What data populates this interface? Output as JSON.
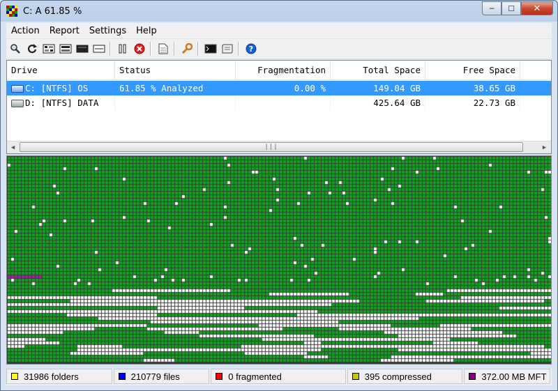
{
  "window": {
    "title": "C:  A  61.85 %"
  },
  "menu": [
    "Action",
    "Report",
    "Settings",
    "Help"
  ],
  "toolbar": [
    {
      "icon": "magnifier-icon",
      "name": "analyze-button"
    },
    {
      "icon": "refresh-icon",
      "name": "defragment-button"
    },
    {
      "icon": "quick-optimize-icon",
      "name": "quick-optimize-button"
    },
    {
      "icon": "full-optimize-icon",
      "name": "full-optimize-button"
    },
    {
      "icon": "mft-optimize-icon",
      "name": "mft-optimize-button"
    },
    {
      "icon": "sep"
    },
    {
      "icon": "pause-icon",
      "name": "pause-button"
    },
    {
      "icon": "stop-icon",
      "name": "stop-button"
    },
    {
      "icon": "sep"
    },
    {
      "icon": "report-icon",
      "name": "report-button"
    },
    {
      "icon": "sep"
    },
    {
      "icon": "wrench-icon",
      "name": "settings-button"
    },
    {
      "icon": "sep"
    },
    {
      "icon": "console-icon",
      "name": "boot-time-button"
    },
    {
      "icon": "script-icon",
      "name": "script-button"
    },
    {
      "icon": "sep"
    },
    {
      "icon": "help-icon",
      "name": "help-button"
    }
  ],
  "drives": {
    "columns": [
      "Drive",
      "Status",
      "Fragmentation",
      "Total Space",
      "Free Space",
      "% "
    ],
    "rows": [
      {
        "drive": "C: [NTFS]  OS",
        "status": "61.85 % Analyzed",
        "fragmentation": "0.00 %",
        "total": "149.04 GB",
        "free": "38.65 GB",
        "selected": true
      },
      {
        "drive": "D: [NTFS]  DATA",
        "status": "",
        "fragmentation": "",
        "total": "425.64 GB",
        "free": "22.73 GB",
        "selected": false
      }
    ]
  },
  "cluster_map": {
    "colors": {
      "used": "#0ca61c",
      "free": "#ffffff",
      "mft": "#a020a0",
      "grid": "#3a3a3a"
    },
    "legend": [
      "green = used",
      "white = free space",
      "magenta = MFT"
    ],
    "analyzed_progress": 0.6185
  },
  "status_bar": [
    {
      "label": "31986 folders",
      "color": "#ffff00"
    },
    {
      "label": "210779 files",
      "color": "#0000ff"
    },
    {
      "label": "0 fragmented",
      "color": "#ff0000"
    },
    {
      "label": "395 compressed",
      "color": "#c8c800"
    },
    {
      "label": "372.00 MB MFT",
      "color": "#800080"
    }
  ]
}
